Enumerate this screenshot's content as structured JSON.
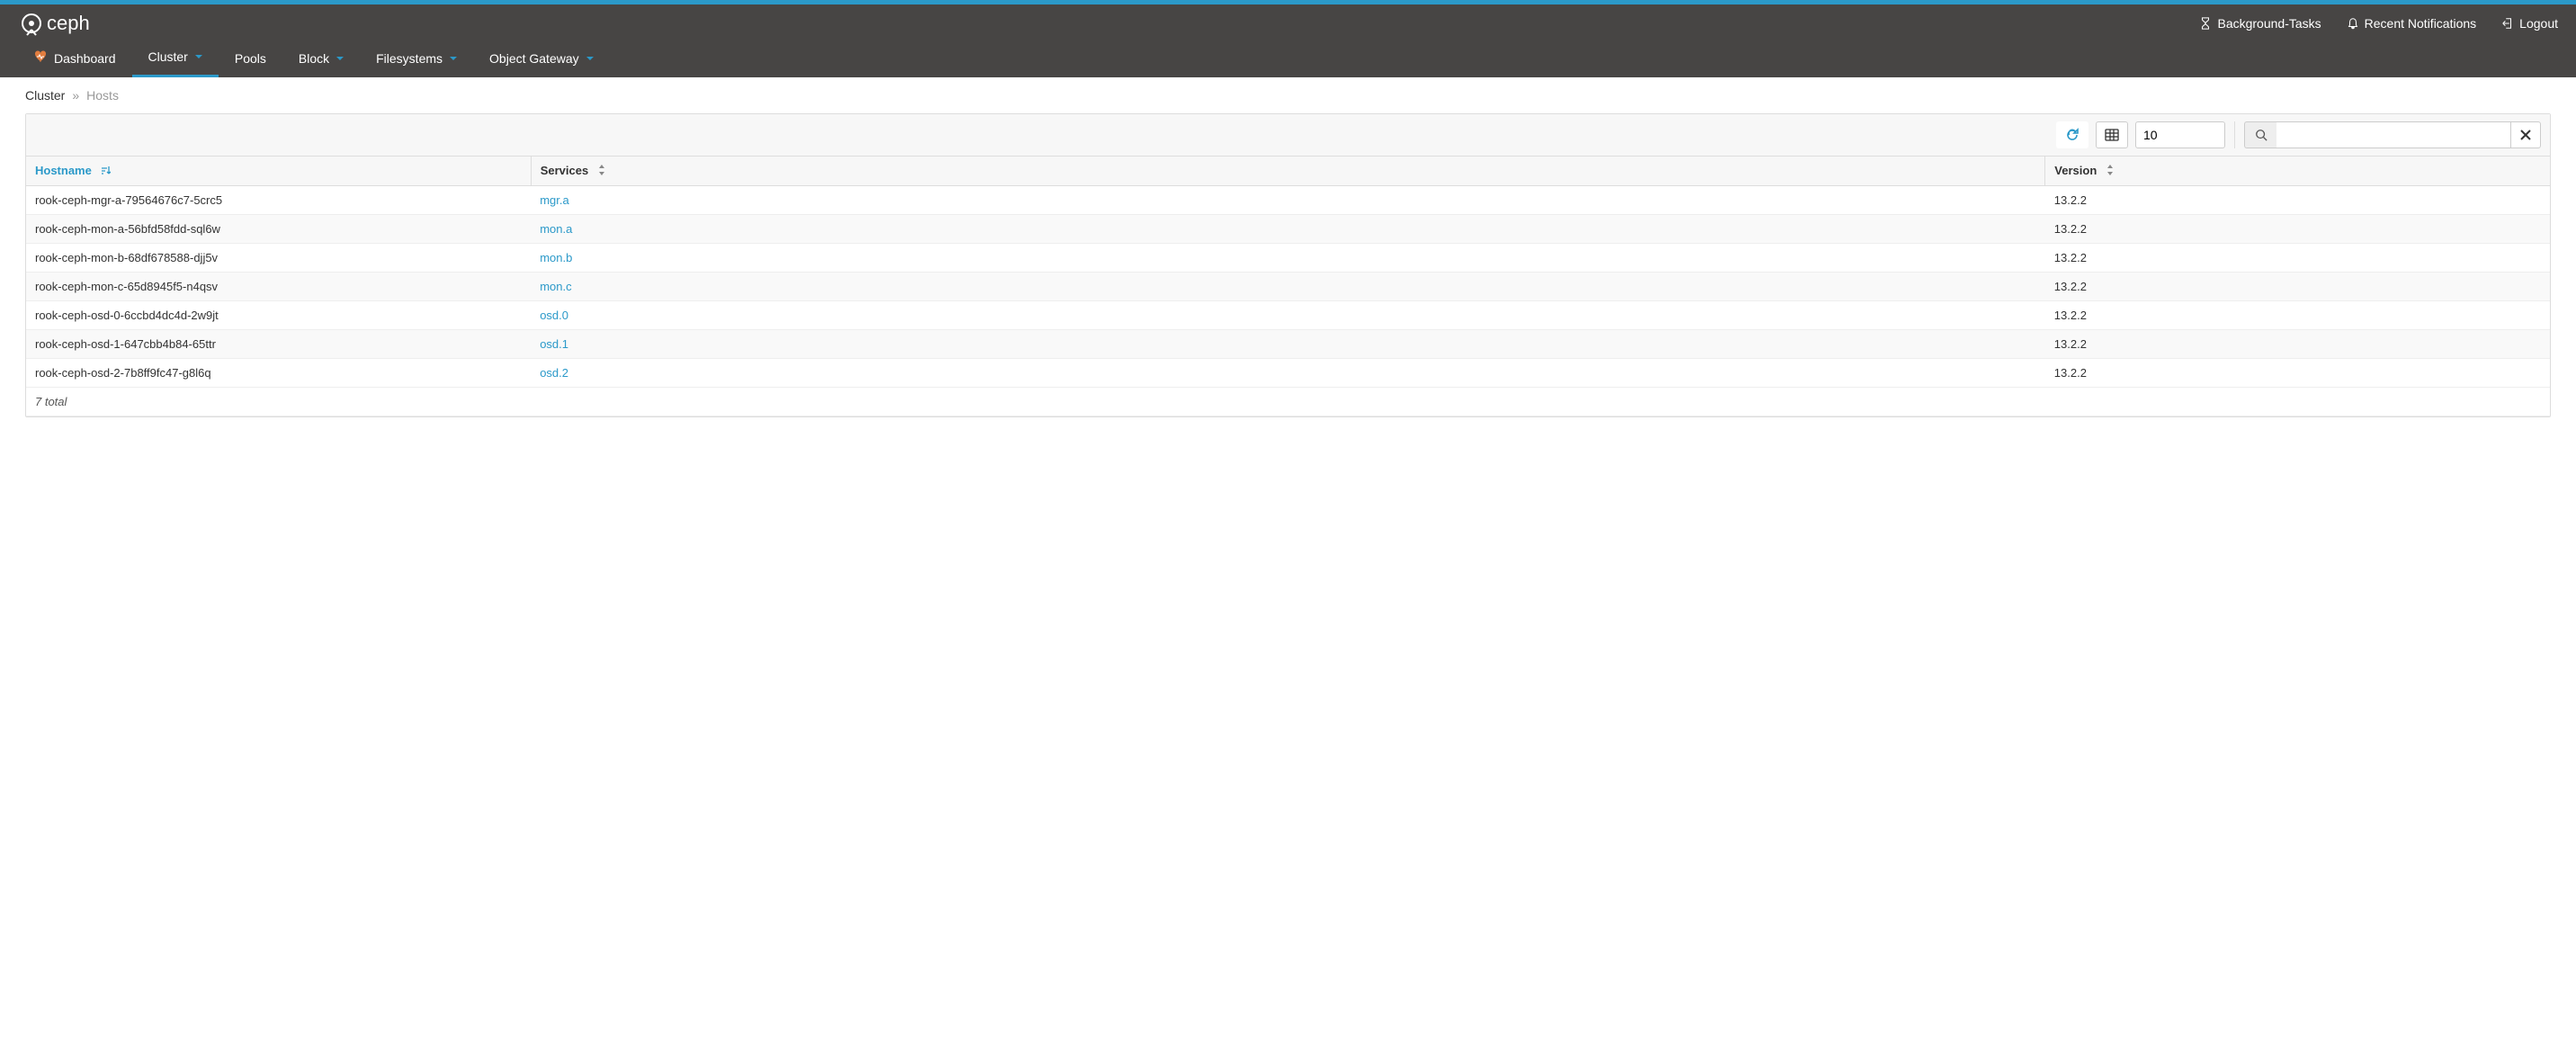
{
  "brand": "ceph",
  "header": {
    "background_tasks": "Background-Tasks",
    "recent_notifications": "Recent Notifications",
    "logout": "Logout"
  },
  "nav": {
    "dashboard": "Dashboard",
    "cluster": "Cluster",
    "pools": "Pools",
    "block": "Block",
    "filesystems": "Filesystems",
    "object_gateway": "Object Gateway"
  },
  "breadcrumb": {
    "parent": "Cluster",
    "current": "Hosts"
  },
  "toolbar": {
    "limit": "10",
    "search": ""
  },
  "table": {
    "columns": {
      "hostname": "Hostname",
      "services": "Services",
      "version": "Version"
    },
    "rows": [
      {
        "hostname": "rook-ceph-mgr-a-79564676c7-5crc5",
        "service": "mgr.a",
        "version": "13.2.2"
      },
      {
        "hostname": "rook-ceph-mon-a-56bfd58fdd-sql6w",
        "service": "mon.a",
        "version": "13.2.2"
      },
      {
        "hostname": "rook-ceph-mon-b-68df678588-djj5v",
        "service": "mon.b",
        "version": "13.2.2"
      },
      {
        "hostname": "rook-ceph-mon-c-65d8945f5-n4qsv",
        "service": "mon.c",
        "version": "13.2.2"
      },
      {
        "hostname": "rook-ceph-osd-0-6ccbd4dc4d-2w9jt",
        "service": "osd.0",
        "version": "13.2.2"
      },
      {
        "hostname": "rook-ceph-osd-1-647cbb4b84-65ttr",
        "service": "osd.1",
        "version": "13.2.2"
      },
      {
        "hostname": "rook-ceph-osd-2-7b8ff9fc47-g8l6q",
        "service": "osd.2",
        "version": "13.2.2"
      }
    ],
    "total_label": "7 total"
  }
}
